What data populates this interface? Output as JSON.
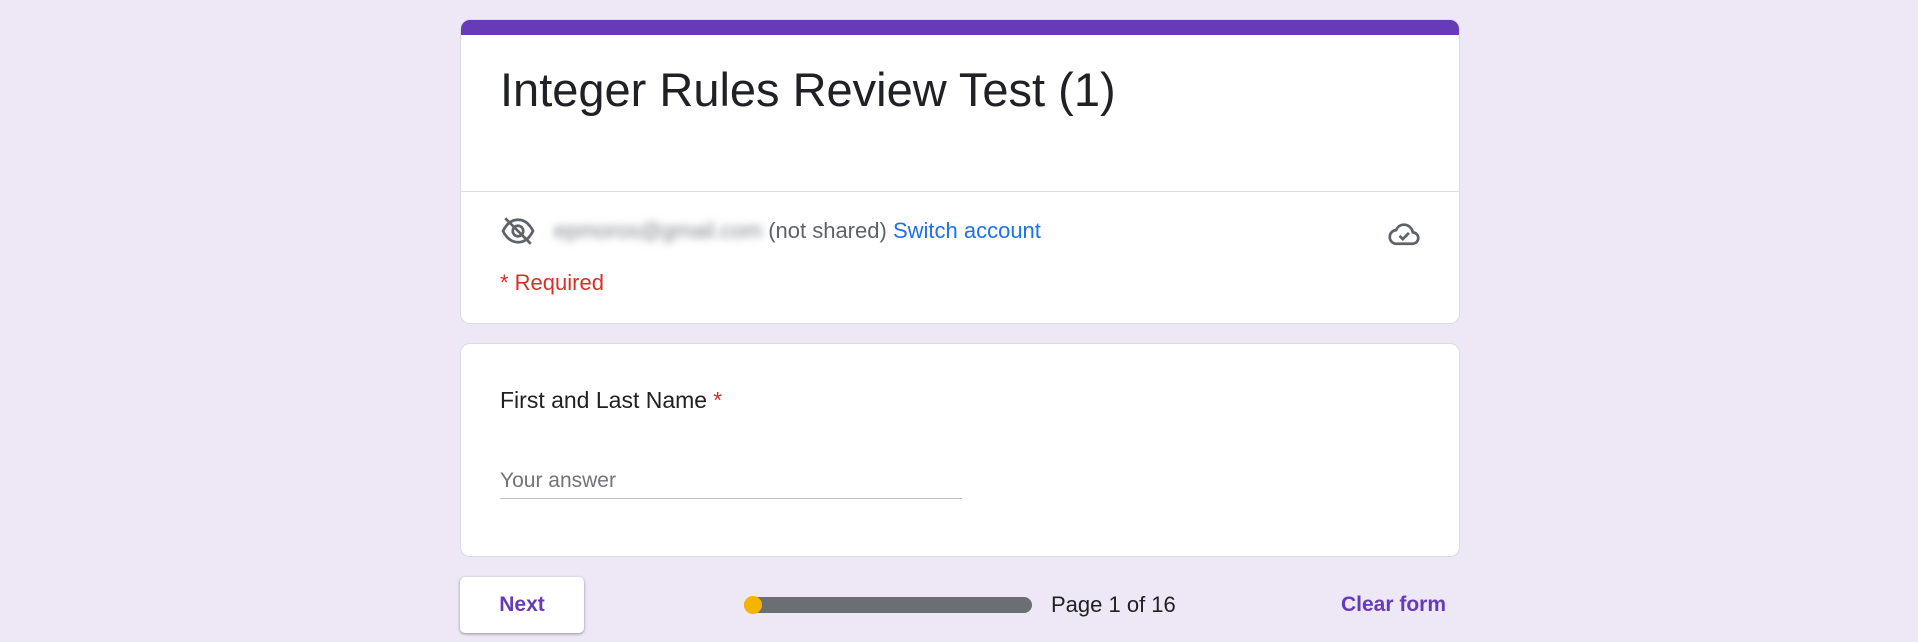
{
  "form": {
    "title": "Integer Rules Review Test (1)",
    "accent_color": "#673ab7",
    "background_color": "#ede7f6"
  },
  "account": {
    "email": "epmoros@gmail.com",
    "shared_status": "(not shared)",
    "switch_label": "Switch account",
    "visibility_icon": "eye-off-icon",
    "save_status_icon": "cloud-check-icon"
  },
  "required_note": "* Required",
  "question": {
    "label": "First and Last Name",
    "required_mark": "*",
    "placeholder": "Your answer",
    "value": ""
  },
  "footer": {
    "next_label": "Next",
    "progress_fraction": 0.0625,
    "page_text": "Page 1 of 16",
    "clear_label": "Clear form",
    "progress_color": "#f4b400"
  }
}
